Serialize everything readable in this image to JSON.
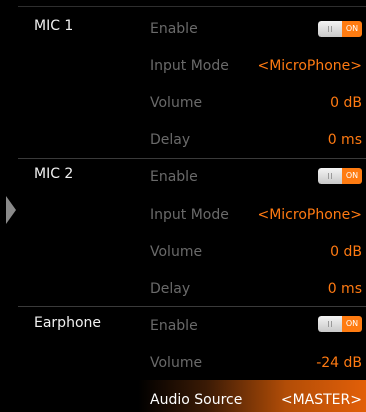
{
  "groups": [
    {
      "name": "MIC 1",
      "rows": [
        {
          "label": "Enable",
          "toggle": "ON"
        },
        {
          "label": "Input Mode",
          "value": "<MicroPhone>"
        },
        {
          "label": "Volume",
          "value": "0 dB"
        },
        {
          "label": "Delay",
          "value": "0 ms"
        }
      ]
    },
    {
      "name": "MIC 2",
      "rows": [
        {
          "label": "Enable",
          "toggle": "ON"
        },
        {
          "label": "Input Mode",
          "value": "<MicroPhone>"
        },
        {
          "label": "Volume",
          "value": "0 dB"
        },
        {
          "label": "Delay",
          "value": "0 ms"
        }
      ]
    },
    {
      "name": "Earphone",
      "rows": [
        {
          "label": "Enable",
          "toggle": "ON"
        },
        {
          "label": "Volume",
          "value": "-24 dB"
        },
        {
          "label": "Audio Source",
          "value": "<MASTER>"
        }
      ]
    }
  ],
  "colors": {
    "accent": "#ff7a12",
    "label_dim": "#6a6a6a",
    "background": "#000000"
  },
  "selected": "groups.2.rows.2"
}
